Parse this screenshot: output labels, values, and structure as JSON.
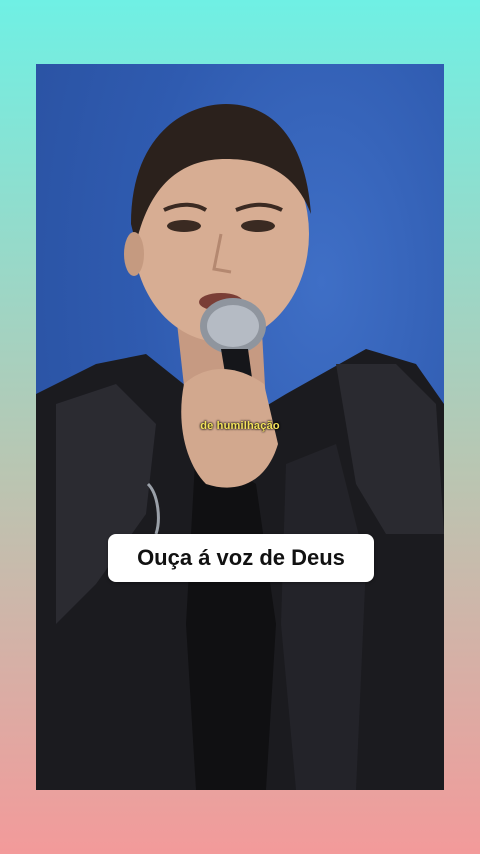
{
  "video": {
    "subtitle": "de humilhação",
    "caption": "Ouça á voz de Deus"
  },
  "colors": {
    "background_top": "#6ff0e4",
    "background_bottom": "#f39a9a",
    "subtitle_color": "#f3e25b",
    "caption_bg": "#ffffff"
  }
}
